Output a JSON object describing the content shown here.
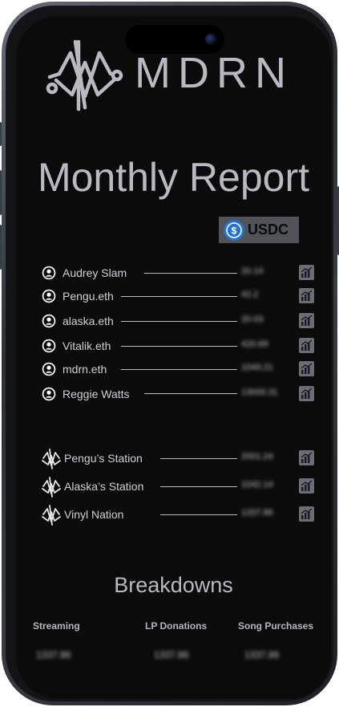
{
  "brand": {
    "name": "MDRN"
  },
  "title": "Monthly Report",
  "currency": {
    "label": "USDC",
    "icon": "usdc-coin-icon",
    "color": "#2775ca"
  },
  "artists": [
    {
      "name": "Audrey Slam",
      "amount": "20.14"
    },
    {
      "name": "Pengu.eth",
      "amount": "42.2"
    },
    {
      "name": "alaska.eth",
      "amount": "20.03"
    },
    {
      "name": "Vitalik.eth",
      "amount": "420.69"
    },
    {
      "name": "mdrn.eth",
      "amount": "1049.21"
    },
    {
      "name": "Reggie Watts",
      "amount": "13000.31"
    }
  ],
  "stations": [
    {
      "name": "Pengu’s Station",
      "amount": "2001.24"
    },
    {
      "name": "Alaska’s Station",
      "amount": "1042.14"
    },
    {
      "name": "Vinyl Nation",
      "amount": "1337.86"
    }
  ],
  "breakdowns": {
    "title": "Breakdowns",
    "items": [
      {
        "label": "Streaming",
        "value": "1337.86"
      },
      {
        "label": "LP Donations",
        "value": "1337.86"
      },
      {
        "label": "Song Purchases",
        "value": "1337.86"
      }
    ]
  },
  "icons": {
    "row_action": "bar-chart-icon",
    "person": "user-avatar-icon",
    "station": "mdrn-station-icon"
  }
}
